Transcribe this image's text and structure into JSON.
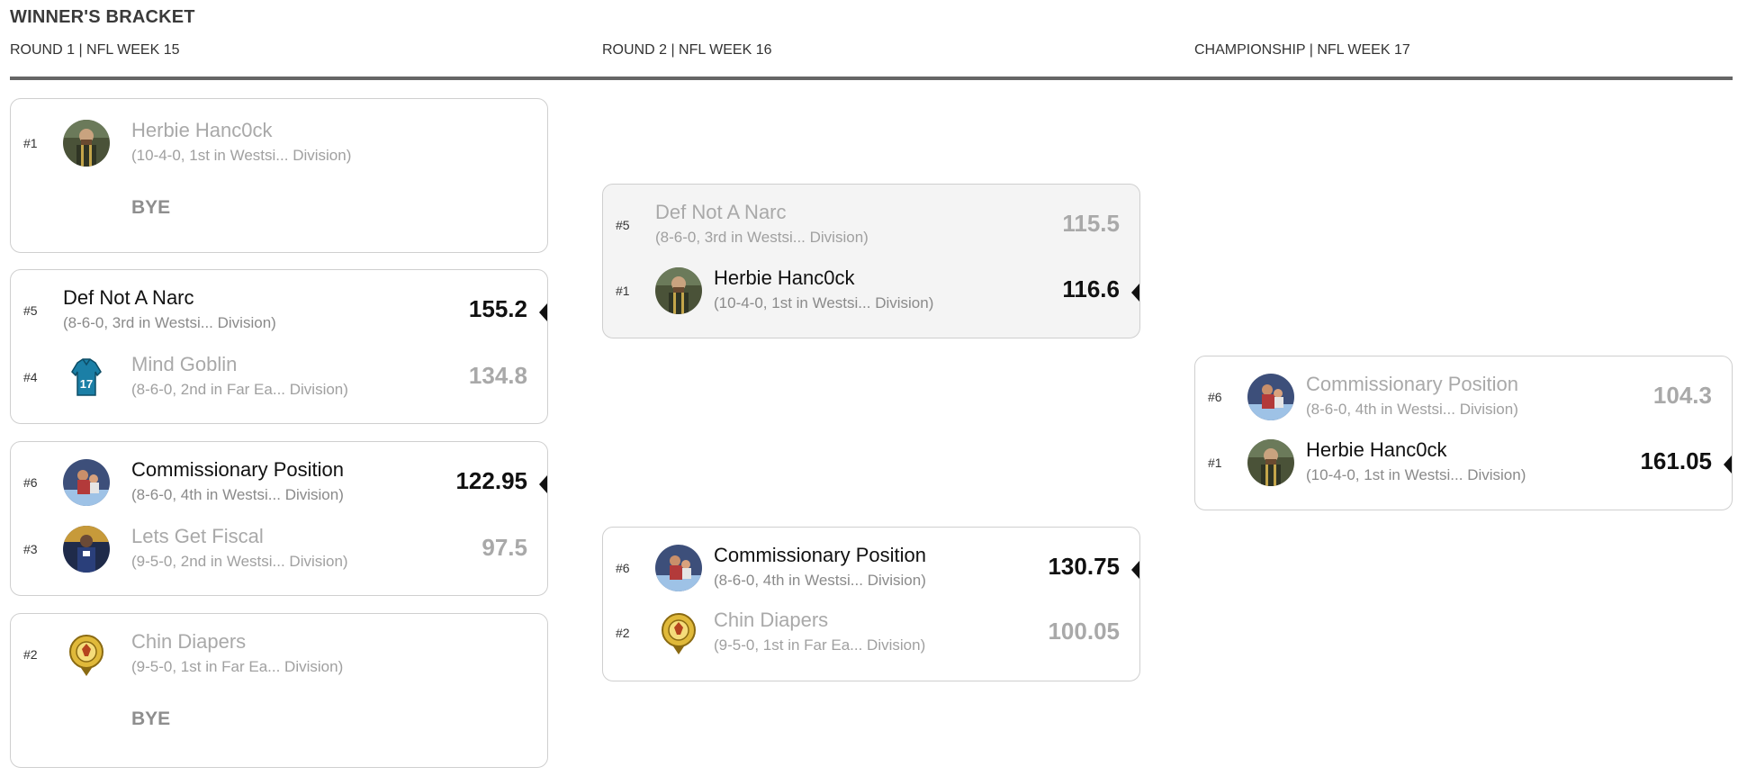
{
  "page": {
    "title": "WINNER'S BRACKET"
  },
  "rounds": [
    {
      "label": "ROUND 1 | NFL WEEK 15"
    },
    {
      "label": "ROUND 2 | NFL WEEK 16"
    },
    {
      "label": "CHAMPIONSHIP | NFL WEEK 17"
    }
  ],
  "colors": {
    "winner_text": "#111111",
    "loser_text": "#a9a9a9",
    "divider": "#666666",
    "card_border": "#cfcfcf"
  },
  "matchups": {
    "r1_m1": {
      "team1": {
        "seed": "#1",
        "name": "Herbie Hanc0ck",
        "record": "(10-4-0, 1st in Westsi... Division)",
        "avatar_icon": "bearded-man-avatar-icon"
      },
      "bye": "BYE"
    },
    "r1_m2": {
      "team1": {
        "seed": "#5",
        "name": "Def Not A Narc",
        "record": "(8-6-0, 3rd in Westsi... Division)",
        "score": "155.2",
        "winner": true
      },
      "team2": {
        "seed": "#4",
        "name": "Mind Goblin",
        "record": "(8-6-0, 2nd in Far Ea... Division)",
        "score": "134.8",
        "avatar_icon": "jersey-17-icon"
      }
    },
    "r1_m3": {
      "team1": {
        "seed": "#6",
        "name": "Commissionary Position",
        "record": "(8-6-0, 4th in Westsi... Division)",
        "score": "122.95",
        "winner": true,
        "avatar_icon": "wrestling-avatar-icon"
      },
      "team2": {
        "seed": "#3",
        "name": "Lets Get Fiscal",
        "record": "(9-5-0, 2nd in Westsi... Division)",
        "score": "97.5",
        "avatar_icon": "player-avatar-icon"
      }
    },
    "r1_m4": {
      "team1": {
        "seed": "#2",
        "name": "Chin Diapers",
        "record": "(9-5-0, 1st in Far Ea... Division)",
        "avatar_icon": "clan-crest-icon"
      },
      "bye": "BYE"
    },
    "r2_m1": {
      "team1": {
        "seed": "#5",
        "name": "Def Not A Narc",
        "record": "(8-6-0, 3rd in Westsi... Division)",
        "score": "115.5"
      },
      "team2": {
        "seed": "#1",
        "name": "Herbie Hanc0ck",
        "record": "(10-4-0, 1st in Westsi... Division)",
        "score": "116.6",
        "winner": true,
        "avatar_icon": "bearded-man-avatar-icon"
      }
    },
    "r2_m2": {
      "team1": {
        "seed": "#6",
        "name": "Commissionary Position",
        "record": "(8-6-0, 4th in Westsi... Division)",
        "score": "130.75",
        "winner": true,
        "avatar_icon": "wrestling-avatar-icon"
      },
      "team2": {
        "seed": "#2",
        "name": "Chin Diapers",
        "record": "(9-5-0, 1st in Far Ea... Division)",
        "score": "100.05",
        "avatar_icon": "clan-crest-icon"
      }
    },
    "final": {
      "team1": {
        "seed": "#6",
        "name": "Commissionary Position",
        "record": "(8-6-0, 4th in Westsi... Division)",
        "score": "104.3",
        "avatar_icon": "wrestling-avatar-icon"
      },
      "team2": {
        "seed": "#1",
        "name": "Herbie Hanc0ck",
        "record": "(10-4-0, 1st in Westsi... Division)",
        "score": "161.05",
        "winner": true,
        "avatar_icon": "bearded-man-avatar-icon"
      }
    }
  }
}
